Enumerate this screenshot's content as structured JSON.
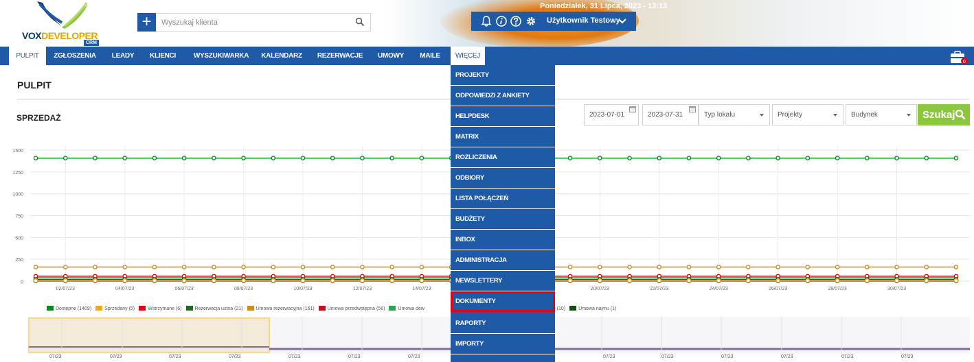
{
  "header": {
    "logo": {
      "word_a": "VOX",
      "word_b": "DEVELOPER",
      "sub": "CRM"
    },
    "search": {
      "placeholder": "Wyszukaj klienta"
    },
    "datetime": "Poniedziałek, 31 Lipca, 2023 - 13:13",
    "user": {
      "name": "Użytkownik Testowy"
    },
    "icons": [
      "bell-icon",
      "info-icon",
      "help-icon",
      "gear-icon",
      "chevron-down-icon"
    ],
    "colors": {
      "brand_blue": "#1f5aa6",
      "accent_green": "#8cc63f",
      "highlight_red": "#e10514"
    }
  },
  "nav": {
    "items": [
      {
        "label": "PULPIT",
        "active": true
      },
      {
        "label": "ZGŁOSZENIA"
      },
      {
        "label": "LEADY"
      },
      {
        "label": "KLIENCI"
      },
      {
        "label": "WYSZUKIWARKA"
      },
      {
        "label": "KALENDARZ"
      },
      {
        "label": "REZERWACJE"
      },
      {
        "label": "UMOWY"
      },
      {
        "label": "MAILE"
      },
      {
        "label": "WIĘCEJ",
        "active": true
      }
    ],
    "briefcase_badge": "0"
  },
  "more_menu": {
    "items": [
      "PROJEKTY",
      "ODPOWIEDZI Z ANKIETY",
      "HELPDESK",
      "MATRIX",
      "ROZLICZENIA",
      "ODBIORY",
      "LISTA POŁĄCZEŃ",
      "BUDŻETY",
      "INBOX",
      "ADMINISTRACJA",
      "NEWSLETTERY",
      "DOKUMENTY",
      "RAPORTY",
      "IMPORTY"
    ],
    "highlighted": "DOKUMENTY"
  },
  "page": {
    "title": "PULPIT",
    "section": "SPRZEDAŻ"
  },
  "filters": {
    "date_from": "2023-07-01",
    "date_to": "2023-07-31",
    "type": "Typ lokalu",
    "projects": "Projekty",
    "building": "Budynek",
    "search_label": "Szukaj"
  },
  "chart_data": {
    "type": "line",
    "x": [
      "01/07/23",
      "02/07/23",
      "03/07/23",
      "04/07/23",
      "05/07/23",
      "06/07/23",
      "07/07/23",
      "08/07/23",
      "09/07/23",
      "10/07/23",
      "11/07/23",
      "12/07/23",
      "13/07/23",
      "14/07/23",
      "15/07/23",
      "16/07/23",
      "17/07/23",
      "18/07/23",
      "19/07/23",
      "20/07/23",
      "21/07/23",
      "22/07/23",
      "23/07/23",
      "24/07/23",
      "25/07/23",
      "26/07/23",
      "27/07/23",
      "28/07/23",
      "29/07/23",
      "30/07/23",
      "31/07/23",
      "01/08/23"
    ],
    "x_tick_labels": [
      "02/07/23",
      "04/07/23",
      "06/07/23",
      "08/07/23",
      "10/07/23",
      "12/07/23",
      "14/07/23",
      "20/07/23",
      "22/07/23",
      "24/07/23",
      "26/07/23",
      "28/07/23",
      "30/07/23"
    ],
    "y_ticks": [
      "0",
      "250",
      "500",
      "750",
      "1000",
      "1250",
      "1500"
    ],
    "ylim": [
      0,
      1500
    ],
    "grid": true,
    "legend_position": "bottom",
    "series": [
      {
        "name": "Dostępne (1409)",
        "color": "#0a8a1c",
        "value": 1409
      },
      {
        "name": "Sprzedany (5)",
        "color": "#f5a623",
        "value": 5
      },
      {
        "name": "Wstrzymane (6)",
        "color": "#e10514",
        "value": 6
      },
      {
        "name": "Rezerwacja ustna (21)",
        "color": "#1e6b1e",
        "value": 21
      },
      {
        "name": "Umowa rezerwacyjna (161)",
        "color": "#d68a1a",
        "value": 161
      },
      {
        "name": "Umowa przedwstępna (56)",
        "color": "#c4101c",
        "value": 56
      },
      {
        "name": "Umowa dew",
        "color": "#2ea44f",
        "value": 40
      },
      {
        "name": "ebrano (10)",
        "color": "#8a6d3b",
        "value": 10
      },
      {
        "name": "Umowa najmu (1)",
        "color": "#134e13",
        "value": 1
      }
    ]
  },
  "navigator": {
    "labels": [
      "07/23",
      "07/23",
      "07/23",
      "07/23",
      "07/23",
      "07/23",
      "07/23",
      "07/23",
      "07/23",
      "07/23",
      "07/23",
      "07/23",
      "07/23",
      "07/23",
      "07/23"
    ]
  }
}
